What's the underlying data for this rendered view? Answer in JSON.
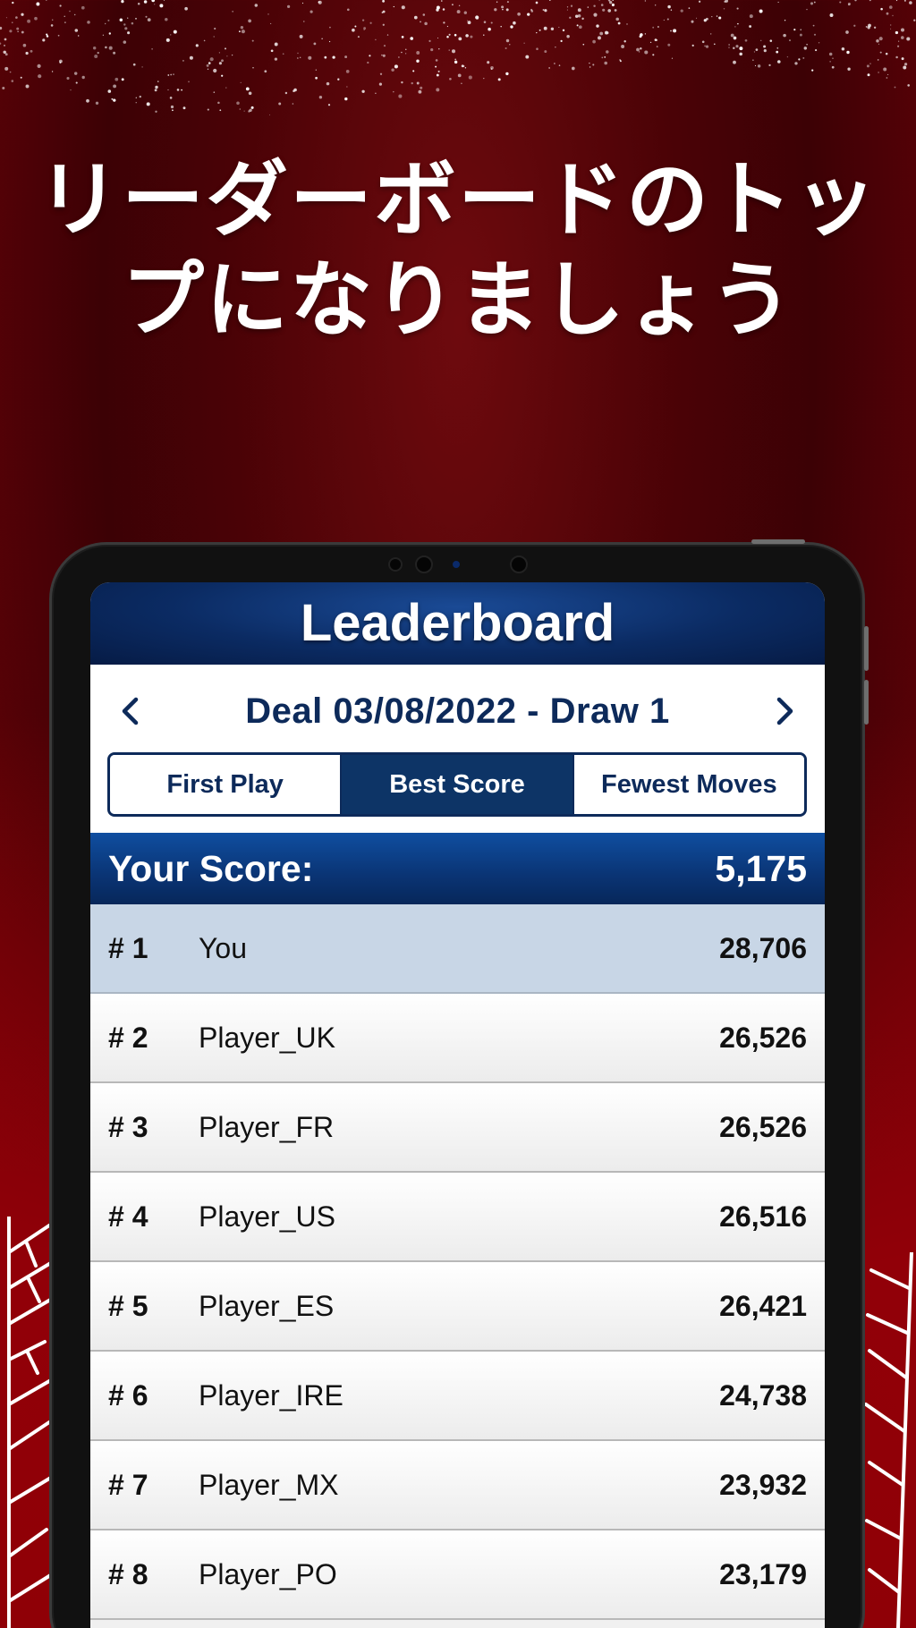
{
  "headline": {
    "line1": "リーダーボードのトッ",
    "line2": "プになりましょう"
  },
  "leaderboard": {
    "title": "Leaderboard",
    "deal_title": "Deal 03/08/2022 - Draw 1",
    "prev_icon": "chevron-left-icon",
    "next_icon": "chevron-right-icon",
    "tabs": [
      {
        "label": "First Play",
        "active": false
      },
      {
        "label": "Best Score",
        "active": true
      },
      {
        "label": "Fewest Moves",
        "active": false
      }
    ],
    "your_score_label": "Your Score:",
    "your_score_value": "5,175",
    "rows": [
      {
        "rank": "# 1",
        "name": "You",
        "score": "28,706",
        "highlight": true
      },
      {
        "rank": "# 2",
        "name": "Player_UK",
        "score": "26,526"
      },
      {
        "rank": "# 3",
        "name": "Player_FR",
        "score": "26,526"
      },
      {
        "rank": "# 4",
        "name": "Player_US",
        "score": "26,516"
      },
      {
        "rank": "# 5",
        "name": "Player_ES",
        "score": "26,421"
      },
      {
        "rank": "# 6",
        "name": "Player_IRE",
        "score": "24,738"
      },
      {
        "rank": "# 7",
        "name": "Player_MX",
        "score": "23,932"
      },
      {
        "rank": "# 8",
        "name": "Player_PO",
        "score": "23,179"
      }
    ]
  },
  "colors": {
    "background_red": "#6e0a0e",
    "navy": "#0d2a5a",
    "header_blue": "#0b2b63",
    "highlight_row": "#c8d6e6"
  }
}
